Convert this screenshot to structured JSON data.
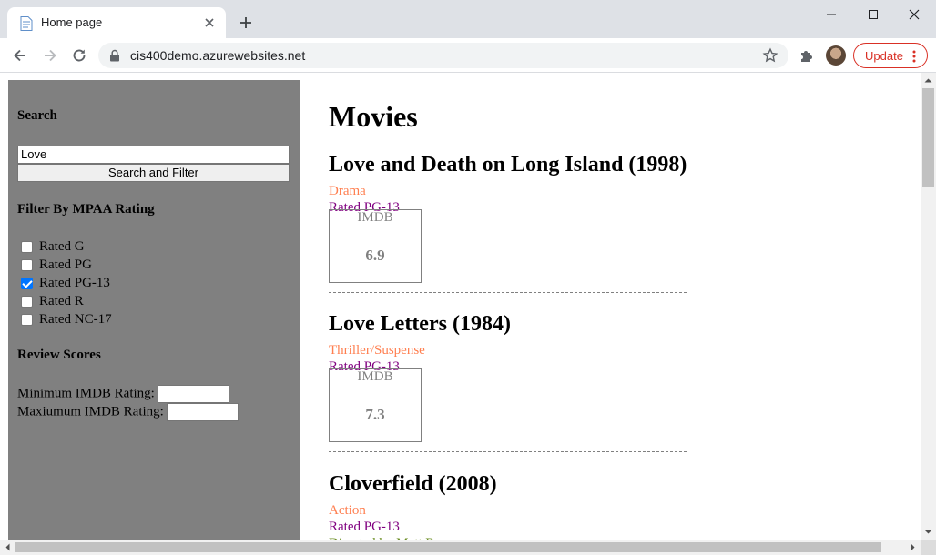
{
  "browser": {
    "tab_title": "Home page",
    "url": "cis400demo.azurewebsites.net",
    "update_label": "Update"
  },
  "sidebar": {
    "search_heading": "Search",
    "search_value": "Love",
    "search_button": "Search and Filter",
    "filter_heading": "Filter By MPAA Rating",
    "ratings": [
      {
        "label": "Rated G",
        "checked": false
      },
      {
        "label": "Rated PG",
        "checked": false
      },
      {
        "label": "Rated PG-13",
        "checked": true
      },
      {
        "label": "Rated R",
        "checked": false
      },
      {
        "label": "Rated NC-17",
        "checked": false
      }
    ],
    "review_heading": "Review Scores",
    "min_imdb_label": "Minimum IMDB Rating:",
    "max_imdb_label": "Maxiumum IMDB Rating:"
  },
  "main": {
    "title": "Movies",
    "imdb_label": "IMDB",
    "movies": [
      {
        "title": "Love and Death on Long Island (1998)",
        "genre": "Drama",
        "rating": "Rated PG-13",
        "imdb": "6.9"
      },
      {
        "title": "Love Letters (1984)",
        "genre": "Thriller/Suspense",
        "rating": "Rated PG-13",
        "imdb": "7.3"
      },
      {
        "title": "Cloverfield (2008)",
        "genre": "Action",
        "rating": "Rated PG-13",
        "director": "Directed by Matt Reeves"
      }
    ]
  }
}
